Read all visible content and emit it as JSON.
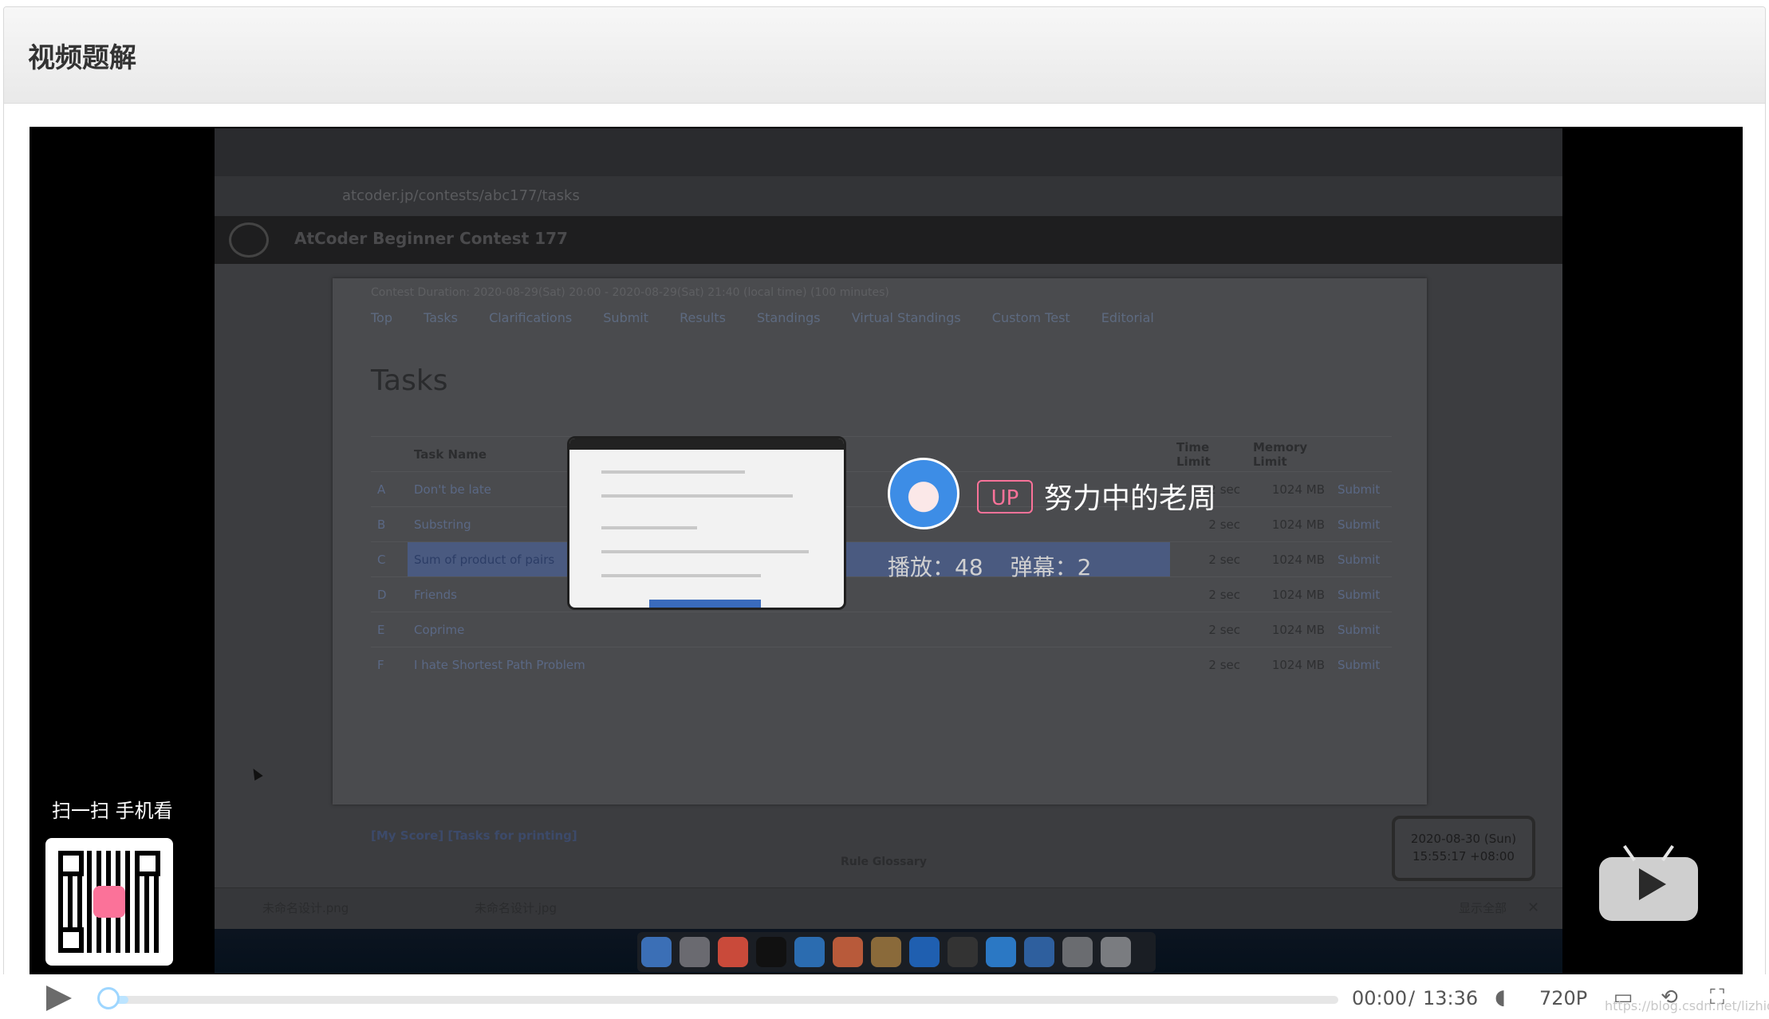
{
  "page": {
    "title": "视频题解"
  },
  "recording": {
    "url": "atcoder.jp/contests/abc177/tasks",
    "site_title": "AtCoder Beginner Contest 177",
    "contest_duration": "Contest Duration: 2020-08-29(Sat) 20:00 - 2020-08-29(Sat) 21:40 (local time) (100 minutes)",
    "nav": [
      "Top",
      "Tasks",
      "Clarifications",
      "Submit",
      "Results",
      "Standings",
      "Virtual Standings",
      "Custom Test",
      "Editorial"
    ],
    "tasks_heading": "Tasks",
    "table_headers": [
      "",
      "Task Name",
      "Time Limit",
      "Memory Limit",
      ""
    ],
    "tasks": [
      {
        "letter": "A",
        "name": "Don't be late",
        "time": "2 sec",
        "memory": "1024 MB",
        "action": "Submit"
      },
      {
        "letter": "B",
        "name": "Substring",
        "time": "2 sec",
        "memory": "1024 MB",
        "action": "Submit"
      },
      {
        "letter": "C",
        "name": "Sum of product of pairs",
        "time": "2 sec",
        "memory": "1024 MB",
        "action": "Submit"
      },
      {
        "letter": "D",
        "name": "Friends",
        "time": "2 sec",
        "memory": "1024 MB",
        "action": "Submit"
      },
      {
        "letter": "E",
        "name": "Coprime",
        "time": "2 sec",
        "memory": "1024 MB",
        "action": "Submit"
      },
      {
        "letter": "F",
        "name": "I hate Shortest Path Problem",
        "time": "2 sec",
        "memory": "1024 MB",
        "action": "Submit"
      }
    ],
    "card_links": "[My Score]   [Tasks for printing]",
    "footer_links": "Rule   Glossary",
    "clock_date": "2020-08-30 (Sun)",
    "clock_time": "15:55:17 +08:00",
    "download_1": "未命名设计.png",
    "download_2": "未命名设计.jpg",
    "show_all": "显示全部"
  },
  "overlay": {
    "up_badge": "UP",
    "up_name": "努力中的老周",
    "plays": "播放：48",
    "danmaku": "弹幕：2",
    "scan_label": "扫一扫 手机看"
  },
  "controls": {
    "current_time": "00:00",
    "separator": "/",
    "duration": "13:36",
    "quality": "720P",
    "progress_fraction": 0.016,
    "watermark": "https://blog.csdn.net/lizhidie"
  },
  "colors": {
    "accent_pink": "#fb7299",
    "progress_light_blue": "#bce4ff"
  },
  "icons": [
    "play-icon",
    "volume-icon",
    "danmaku-toggle-icon",
    "danmaku-settings-icon",
    "fullscreen-icon",
    "tv-play-icon",
    "qr-code-icon"
  ]
}
